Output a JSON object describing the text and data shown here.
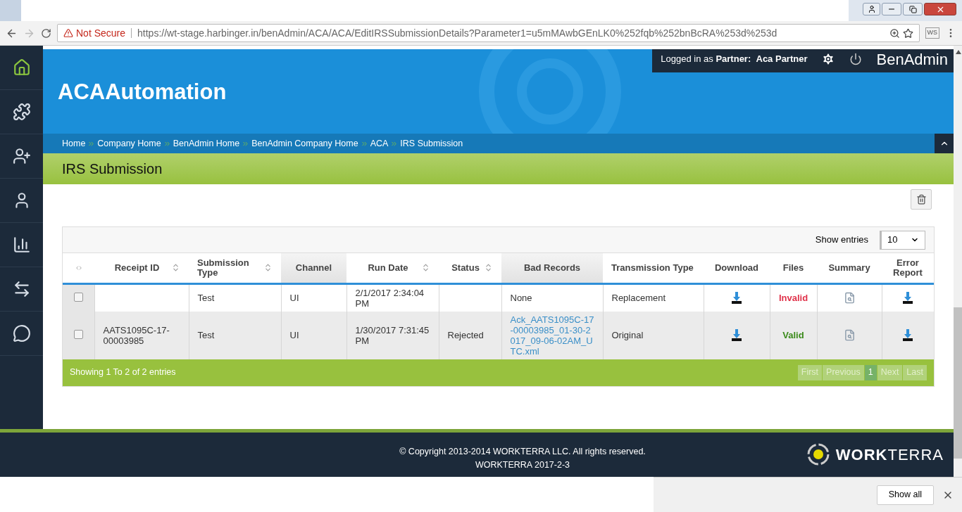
{
  "browser": {
    "security_label": "Not Secure",
    "url": "https://wt-stage.harbinger.in/benAdmin/ACA/ACA/EditIRSSubmissionDetails?Parameter1=u5mMAwbGEnLK0%252fqb%252bnBcRA%253d%253d",
    "extension_label": "WS"
  },
  "user_bar": {
    "prefix": "Logged in as",
    "role": "Partner:",
    "name": "Aca Partner",
    "brand": "BenAdmin"
  },
  "site_title": "ACAAutomation",
  "breadcrumbs": [
    "Home",
    "Company Home",
    "BenAdmin Home",
    "BenAdmin Company Home",
    "ACA",
    "IRS Submission"
  ],
  "page_title": "IRS Submission",
  "table": {
    "show_entries_label": "Show entries",
    "page_size": "10",
    "columns": [
      {
        "kind": "icon"
      },
      {
        "kind": "sortable",
        "label": "Receipt ID"
      },
      {
        "kind": "sortable",
        "label": "Submission Type"
      },
      {
        "kind": "shaded",
        "label": "Channel"
      },
      {
        "kind": "sortable",
        "label": "Run Date"
      },
      {
        "kind": "sortable",
        "label": "Status"
      },
      {
        "kind": "shaded",
        "label": "Bad Records"
      },
      {
        "kind": "plain",
        "label": "Transmission Type"
      },
      {
        "kind": "plain",
        "label": "Download"
      },
      {
        "kind": "plain",
        "label": "Files"
      },
      {
        "kind": "plain",
        "label": "Summary"
      },
      {
        "kind": "plain",
        "label": "Error Report"
      }
    ],
    "rows": [
      {
        "checked": false,
        "receipt_id": "",
        "submission_type": "Test",
        "channel": "UI",
        "run_date": "2/1/2017 2:34:04 PM",
        "status": "",
        "bad_records": {
          "text": "None",
          "link": false
        },
        "transmission_type": "Replacement",
        "files": {
          "text": "Invalid",
          "valid": false
        }
      },
      {
        "checked": false,
        "receipt_id": "AATS1095C-17-00003985",
        "submission_type": "Test",
        "channel": "UI",
        "run_date": "1/30/2017 7:31:45 PM",
        "status": "Rejected",
        "bad_records": {
          "text": "Ack_AATS1095C-17-00003985_01-30-2017_09-06-02AM_UTC.xml",
          "link": true
        },
        "transmission_type": "Original",
        "files": {
          "text": "Valid",
          "valid": true
        }
      }
    ],
    "info": "Showing 1 To 2 of 2 entries",
    "pagination": [
      {
        "label": "First",
        "selected": false,
        "disabled": true
      },
      {
        "label": "Previous",
        "selected": false,
        "disabled": true
      },
      {
        "label": "1",
        "selected": true,
        "disabled": false
      },
      {
        "label": "Next",
        "selected": false,
        "disabled": true
      },
      {
        "label": "Last",
        "selected": false,
        "disabled": true
      }
    ]
  },
  "footer": {
    "copyright": "© Copyright 2013-2014 WORKTERRA LLC. All rights reserved.",
    "version": "WORKTERRA 2017-2-3",
    "logo": "**WORK**TERRA"
  },
  "downloads_bar": {
    "button": "Show all"
  }
}
